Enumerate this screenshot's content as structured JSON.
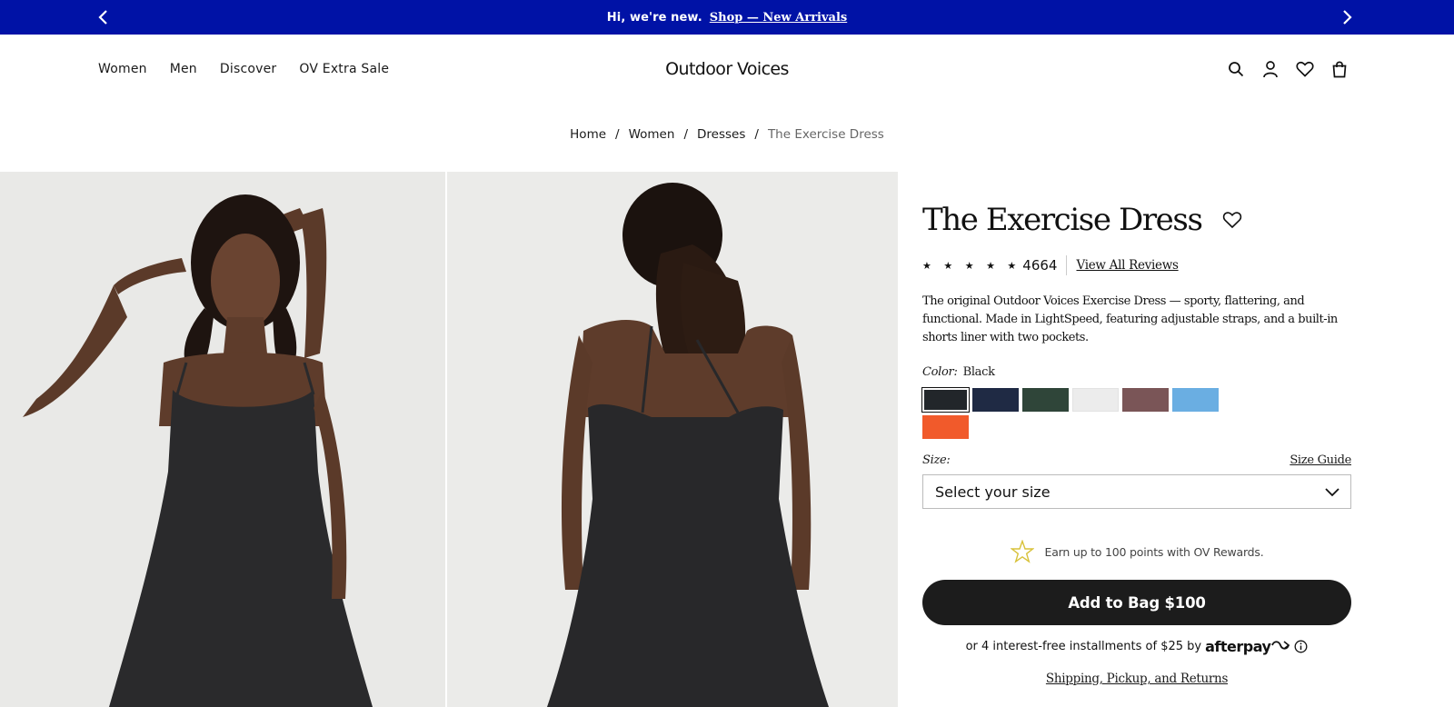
{
  "announcement": {
    "message": "Hi, we're new.",
    "link": "Shop — New Arrivals",
    "prev_icon": "chevron-left-icon",
    "next_icon": "chevron-right-icon"
  },
  "header": {
    "nav": [
      "Women",
      "Men",
      "Discover",
      "OV Extra Sale"
    ],
    "logo": "Outdoor Voices",
    "icons": [
      "search-icon",
      "account-icon",
      "heart-icon",
      "bag-icon"
    ]
  },
  "breadcrumb": {
    "items": [
      "Home",
      "Women",
      "Dresses"
    ],
    "current": "The Exercise Dress",
    "separator": "/"
  },
  "product": {
    "title": "The Exercise Dress",
    "stars": "★ ★ ★ ★ ★",
    "rating_stars": 5,
    "review_count": "4664",
    "view_all_reviews": "View All Reviews",
    "description": "The original Outdoor Voices Exercise Dress — sporty, flattering, and functional. Made in LightSpeed, featuring adjustable straps, and a built-in shorts liner with two pockets.",
    "color_label": "Color:",
    "color_value": "Black",
    "swatches": [
      "#22262a",
      "#1f2a44",
      "#2f4539",
      "#ececec",
      "#7a5557",
      "#6aaee2",
      "#f15a2b"
    ],
    "selected_swatch": 0,
    "size_label": "Size:",
    "size_guide": "Size Guide",
    "size_select": "Select your size",
    "rewards_text": "Earn up to 100 points with OV Rewards.",
    "add_to_bag": "Add to Bag $100",
    "afterpay_text": "or 4 interest-free installments of $25 by",
    "afterpay_brand": "afterpay",
    "shipping_link": "Shipping, Pickup, and Returns"
  },
  "colors": {
    "announcement_bg": "#0012a6",
    "button_bg": "#1c1c1c",
    "rewards_star": "#d8c23a"
  }
}
